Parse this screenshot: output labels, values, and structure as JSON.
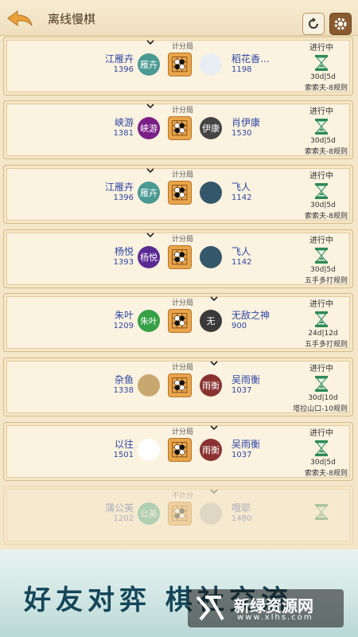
{
  "header": {
    "title": "离线慢棋"
  },
  "games": [
    {
      "mode": "计分局",
      "status": "进行中",
      "time": "30d|5d",
      "rule": "索索夫-8规则",
      "left": {
        "name": "江雁卉",
        "rating": "1396",
        "avatar": "雁卉",
        "color": "#4a9a93"
      },
      "right": {
        "name": "稻花香…",
        "rating": "1198",
        "avatar": "",
        "color": "#e8eef4"
      }
    },
    {
      "mode": "计分局",
      "status": "进行中",
      "time": "30d|5d",
      "rule": "索索夫-8规则",
      "left": {
        "name": "峡游",
        "rating": "1381",
        "avatar": "峡游",
        "color": "#7a1f86"
      },
      "right": {
        "name": "肖伊康",
        "rating": "1530",
        "avatar": "伊康",
        "color": "#444444"
      }
    },
    {
      "mode": "计分局",
      "status": "进行中",
      "time": "30d|5d",
      "rule": "索索夫-8规则",
      "left": {
        "name": "江雁卉",
        "rating": "1396",
        "avatar": "雁卉",
        "color": "#4a9a93"
      },
      "right": {
        "name": "飞人",
        "rating": "1142",
        "avatar": "",
        "color": "#35576a"
      }
    },
    {
      "mode": "计分局",
      "status": "进行中",
      "time": "30d|5d",
      "rule": "五手多打规则",
      "left": {
        "name": "杨悦",
        "rating": "1393",
        "avatar": "杨悦",
        "color": "#5a2b92"
      },
      "right": {
        "name": "飞人",
        "rating": "1142",
        "avatar": "",
        "color": "#35576a"
      }
    },
    {
      "mode": "计分局",
      "status": "进行中",
      "time": "24d|12d",
      "rule": "五手多打规则",
      "left": {
        "name": "朱叶",
        "rating": "1209",
        "avatar": "朱叶",
        "color": "#35a045"
      },
      "right": {
        "name": "无敌之神",
        "rating": "900",
        "avatar": "无",
        "color": "#3a3a3a"
      }
    },
    {
      "mode": "计分局",
      "status": "进行中",
      "time": "30d|10d",
      "rule": "塔拉山口-10规则",
      "left": {
        "name": "杂鱼",
        "rating": "1338",
        "avatar": "",
        "color": "#c9a870"
      },
      "right": {
        "name": "吴雨衡",
        "rating": "1037",
        "avatar": "雨衡",
        "color": "#8a3232"
      }
    },
    {
      "mode": "计分局",
      "status": "进行中",
      "time": "30d|5d",
      "rule": "索索夫-8规则",
      "left": {
        "name": "以往",
        "rating": "1501",
        "avatar": "",
        "color": "#ffffff"
      },
      "right": {
        "name": "吴雨衡",
        "rating": "1037",
        "avatar": "雨衡",
        "color": "#8a3232"
      }
    },
    {
      "mode": "不计分",
      "status": "",
      "time": "",
      "rule": "",
      "left": {
        "name": "蒲公英",
        "rating": "1202",
        "avatar": "公英",
        "color": "#3aa68f"
      },
      "right": {
        "name": "哦耶",
        "rating": "1480",
        "avatar": "",
        "color": "#bbbbbb"
      }
    }
  ],
  "banner": {
    "slogan": "好友对弈 棋社交流"
  },
  "watermark": {
    "name": "新绿资源网",
    "url": "www.xlhs.com"
  }
}
